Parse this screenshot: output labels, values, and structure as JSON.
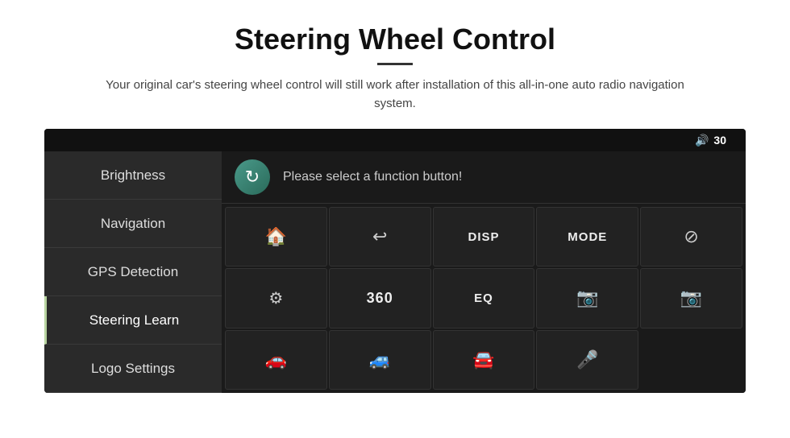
{
  "page": {
    "title": "Steering Wheel Control",
    "subtitle": "Your original car's steering wheel control will still work after installation of this all-in-one auto radio navigation system.",
    "divider": true
  },
  "topbar": {
    "volume_label": "30"
  },
  "sidebar": {
    "items": [
      {
        "id": "brightness",
        "label": "Brightness",
        "active": false
      },
      {
        "id": "navigation",
        "label": "Navigation",
        "active": false
      },
      {
        "id": "gps-detection",
        "label": "GPS Detection",
        "active": false
      },
      {
        "id": "steering-learn",
        "label": "Steering Learn",
        "active": true
      },
      {
        "id": "logo-settings",
        "label": "Logo Settings",
        "active": false
      }
    ]
  },
  "panel": {
    "refresh_button_label": "↻",
    "function_text": "Please select a function button!",
    "buttons": [
      {
        "id": "btn-home",
        "type": "icon",
        "icon": "🏠",
        "row": 1,
        "col": 1
      },
      {
        "id": "btn-back",
        "type": "icon",
        "icon": "↩",
        "row": 1,
        "col": 2
      },
      {
        "id": "btn-disp",
        "type": "text",
        "label": "DISP",
        "row": 1,
        "col": 3
      },
      {
        "id": "btn-mode",
        "type": "text",
        "label": "MODE",
        "row": 1,
        "col": 4
      },
      {
        "id": "btn-mute",
        "type": "icon",
        "icon": "🚫",
        "row": 1,
        "col": 5
      },
      {
        "id": "btn-adjust",
        "type": "icon",
        "icon": "⚙",
        "row": 2,
        "col": 1
      },
      {
        "id": "btn-360",
        "type": "text",
        "label": "360",
        "row": 2,
        "col": 2
      },
      {
        "id": "btn-eq",
        "type": "text",
        "label": "EQ",
        "row": 2,
        "col": 3
      },
      {
        "id": "btn-cam1",
        "type": "icon",
        "icon": "📷",
        "row": 2,
        "col": 4
      },
      {
        "id": "btn-cam2",
        "type": "icon",
        "icon": "📷",
        "row": 2,
        "col": 5
      },
      {
        "id": "btn-car1",
        "type": "icon",
        "icon": "🚗",
        "row": 3,
        "col": 1
      },
      {
        "id": "btn-car2",
        "type": "icon",
        "icon": "🚙",
        "row": 3,
        "col": 2
      },
      {
        "id": "btn-car3",
        "type": "icon",
        "icon": "🚘",
        "row": 3,
        "col": 3
      },
      {
        "id": "btn-mic",
        "type": "icon",
        "icon": "🎤",
        "row": 3,
        "col": 4
      },
      {
        "id": "btn-empty",
        "type": "empty",
        "row": 3,
        "col": 5
      }
    ]
  }
}
